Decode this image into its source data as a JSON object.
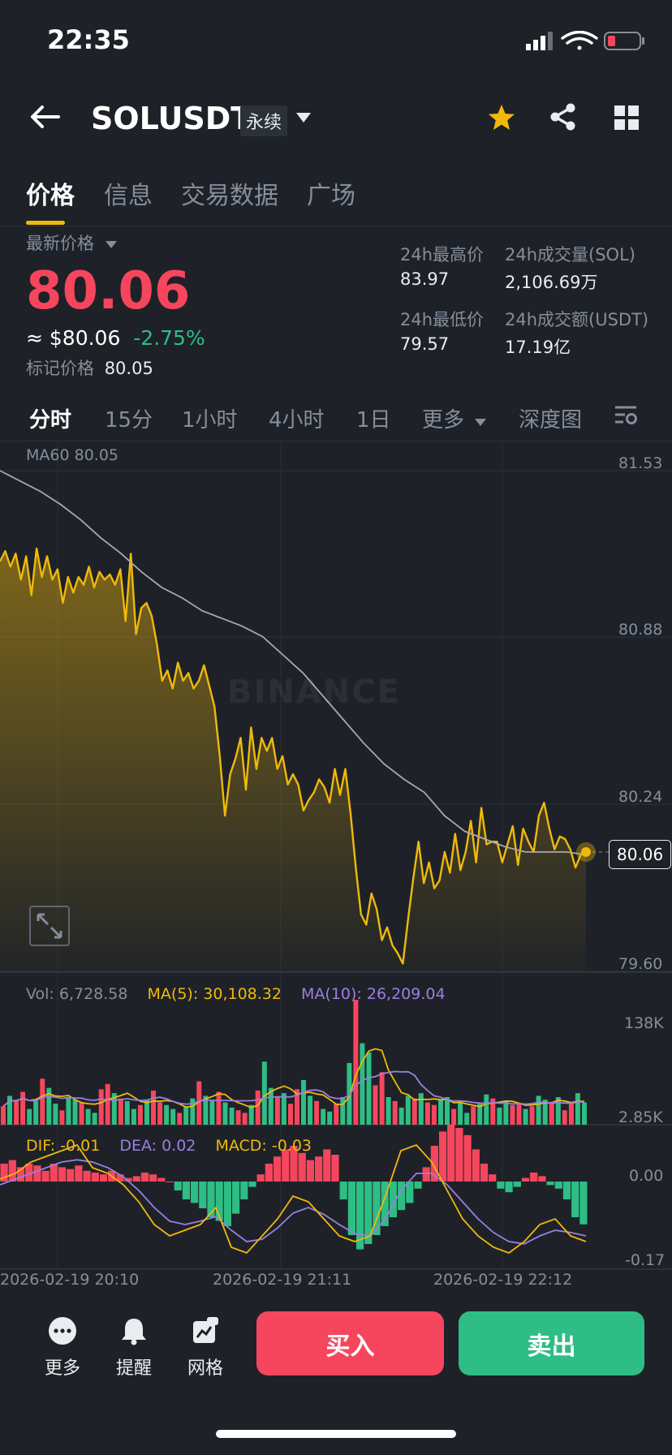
{
  "status_bar": {
    "time": "22:35"
  },
  "nav": {
    "symbol": "SOLUSDT",
    "badge": "永续"
  },
  "tabs": [
    {
      "label": "价格",
      "active": true
    },
    {
      "label": "信息",
      "active": false
    },
    {
      "label": "交易数据",
      "active": false
    },
    {
      "label": "广场",
      "active": false
    }
  ],
  "ticker": {
    "last_price_label": "最新价格",
    "last_price": "80.06",
    "usd_price": "≈ $80.06",
    "change_pct": "-2.75%",
    "mark_price_label": "标记价格",
    "mark_price": "80.05",
    "high_label": "24h最高价",
    "high": "83.97",
    "low_label": "24h最低价",
    "low": "79.57",
    "vol_label": "24h成交量(SOL)",
    "vol": "2,106.69万",
    "turnover_label": "24h成交额(USDT)",
    "turnover": "17.19亿"
  },
  "intervals": [
    {
      "label": "分时",
      "active": true
    },
    {
      "label": "15分",
      "active": false
    },
    {
      "label": "1小时",
      "active": false
    },
    {
      "label": "4小时",
      "active": false
    },
    {
      "label": "1日",
      "active": false
    },
    {
      "label": "更多",
      "active": false
    },
    {
      "label": "深度图",
      "active": false
    }
  ],
  "colors": {
    "up": "#2ebd85",
    "down": "#f6465d",
    "accent": "#f0b90b",
    "ma_line": "#a9a9a9",
    "dea": "#9b7ee0"
  },
  "chart_data": [
    {
      "type": "line",
      "ma_label": "MA60 80.05",
      "watermark": "BINANCE",
      "yticks": [
        "81.53",
        "80.88",
        "80.24",
        "79.60"
      ],
      "ylim": [
        79.6,
        81.53
      ],
      "current_price_tag": "80.06",
      "xticks": [
        "2026-02-19 20:10",
        "2026-02-19 21:11",
        "2026-02-19 22:12"
      ],
      "series": [
        {
          "name": "price",
          "values": [
            81.18,
            81.22,
            81.16,
            81.21,
            81.11,
            81.2,
            81.05,
            81.23,
            81.12,
            81.2,
            81.11,
            81.15,
            81.02,
            81.12,
            81.06,
            81.12,
            81.09,
            81.16,
            81.08,
            81.14,
            81.11,
            81.13,
            81.09,
            81.15,
            80.95,
            81.21,
            80.9,
            81.0,
            81.02,
            80.97,
            80.86,
            80.72,
            80.76,
            80.69,
            80.79,
            80.72,
            80.75,
            80.69,
            80.72,
            80.78,
            80.7,
            80.62,
            80.43,
            80.2,
            80.36,
            80.42,
            80.5,
            80.3,
            80.54,
            80.38,
            80.5,
            80.45,
            80.5,
            80.38,
            80.43,
            80.32,
            80.36,
            80.32,
            80.22,
            80.26,
            80.29,
            80.34,
            80.31,
            80.25,
            80.38,
            80.28,
            80.38,
            80.21,
            80.0,
            79.82,
            79.78,
            79.9,
            79.84,
            79.72,
            79.77,
            79.7,
            79.67,
            79.63,
            79.8,
            79.96,
            80.1,
            79.94,
            80.02,
            79.92,
            79.95,
            80.06,
            79.98,
            80.13,
            79.99,
            80.06,
            80.18,
            80.02,
            80.23,
            80.09,
            80.1,
            80.1,
            80.02,
            80.09,
            80.16,
            80.01,
            80.15,
            80.1,
            80.06,
            80.2,
            80.25,
            80.15,
            80.07,
            80.12,
            80.11,
            80.07,
            80.0,
            80.05,
            80.06
          ]
        },
        {
          "name": "MA60",
          "values": [
            81.53,
            81.49,
            81.45,
            81.4,
            81.34,
            81.27,
            81.21,
            81.14,
            81.08,
            81.04,
            80.99,
            80.96,
            80.93,
            80.89,
            80.82,
            80.75,
            80.66,
            80.57,
            80.48,
            80.4,
            80.34,
            80.29,
            80.2,
            80.14,
            80.11,
            80.08,
            80.06,
            80.06,
            80.06,
            80.05
          ]
        }
      ]
    },
    {
      "type": "bar",
      "vol_label": "Vol: 6,728.58",
      "ma5_label": "MA(5): 30,108.32",
      "ma10_label": "MA(10): 26,209.04",
      "yticks": [
        "138K",
        "2.85K"
      ],
      "ylim": [
        2.85,
        138
      ],
      "values": [
        14,
        22,
        19,
        25,
        12,
        18,
        35,
        28,
        16,
        11,
        21,
        19,
        17,
        12,
        9,
        27,
        31,
        24,
        20,
        18,
        12,
        15,
        19,
        26,
        17,
        15,
        12,
        9,
        14,
        20,
        33,
        22,
        18,
        25,
        17,
        13,
        11,
        9,
        15,
        26,
        48,
        28,
        21,
        24,
        16,
        27,
        34,
        22,
        18,
        12,
        10,
        16,
        21,
        47,
        95,
        62,
        55,
        30,
        40,
        21,
        18,
        13,
        22,
        20,
        24,
        17,
        15,
        19,
        21,
        12,
        18,
        9,
        14,
        16,
        23,
        20,
        13,
        18,
        15,
        16,
        12,
        14,
        22,
        19,
        17,
        21,
        11,
        16,
        24,
        17
      ]
    },
    {
      "type": "bar",
      "dif_label": "DIF: -0.01",
      "dea_label": "DEA: 0.02",
      "macd_label": "MACD: -0.03",
      "yticks": [
        "0.00",
        "-0.17"
      ],
      "ylim": [
        -0.17,
        0.03
      ],
      "values": [
        0.01,
        0.012,
        0.008,
        0.01,
        0.009,
        0.006,
        0.01,
        0.008,
        0.007,
        0.009,
        0.006,
        0.005,
        0.004,
        0.006,
        0.004,
        0.002,
        0.003,
        0.005,
        0.004,
        0.002,
        0.0,
        -0.005,
        -0.01,
        -0.012,
        -0.015,
        -0.02,
        -0.022,
        -0.025,
        -0.018,
        -0.01,
        -0.003,
        0.004,
        0.01,
        0.014,
        0.018,
        0.02,
        0.016,
        0.012,
        0.014,
        0.018,
        0.015,
        -0.01,
        -0.03,
        -0.038,
        -0.035,
        -0.03,
        -0.025,
        -0.02,
        -0.016,
        -0.012,
        -0.004,
        0.008,
        0.02,
        0.028,
        0.032,
        0.03,
        0.026,
        0.018,
        0.01,
        0.004,
        -0.004,
        -0.006,
        -0.003,
        0.002,
        0.005,
        0.003,
        -0.002,
        -0.004,
        -0.01,
        -0.02,
        -0.024
      ]
    }
  ],
  "bottom_bar": {
    "more": "更多",
    "alert": "提醒",
    "grid": "网格",
    "buy": "买入",
    "sell": "卖出"
  }
}
